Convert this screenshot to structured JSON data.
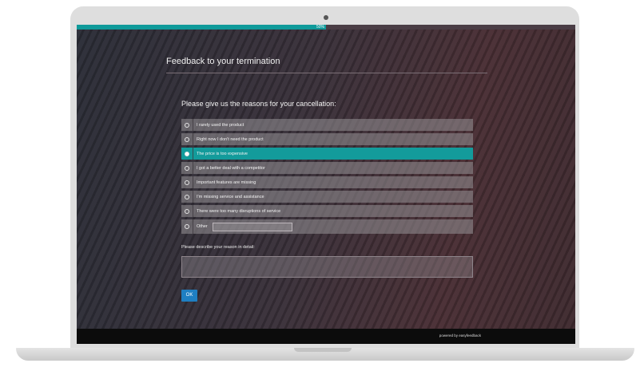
{
  "progress": {
    "percent": 50,
    "label": "50%"
  },
  "page_title": "Feedback to your termination",
  "question": "Please give us the reasons for your cancellation:",
  "options": [
    {
      "label": "I rarely used the product",
      "selected": false
    },
    {
      "label": "Right now I don't need the product",
      "selected": false
    },
    {
      "label": "The price is too expensive",
      "selected": true
    },
    {
      "label": "I got a better deal with a competitor",
      "selected": false
    },
    {
      "label": "Important features are missing",
      "selected": false
    },
    {
      "label": "I'm missing service and assistance",
      "selected": false
    },
    {
      "label": "There were too many disruptions of service",
      "selected": false
    }
  ],
  "other": {
    "label": "Other",
    "value": ""
  },
  "detail": {
    "label": "Please describe your reason in detail:",
    "value": ""
  },
  "ok_label": "OK",
  "footer": {
    "powered_by": "powered by easyfeedback"
  },
  "colors": {
    "accent": "#139b9b",
    "button": "#1f7fc2",
    "progress": "#0f9a9a"
  }
}
